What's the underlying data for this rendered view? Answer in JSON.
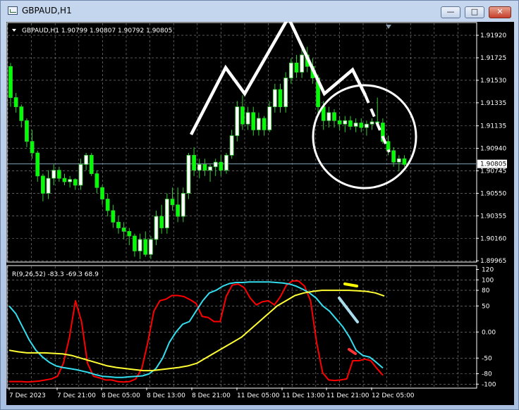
{
  "window": {
    "title": "GBPAUD,H1",
    "minimize_icon": "minimize-icon",
    "maximize_icon": "maximize-icon",
    "close_icon": "close-icon"
  },
  "chart_header": {
    "symbol_info": "GBPAUD,H1  1.90799 1.90807 1.90792 1.90805"
  },
  "indicator_header": {
    "info": "R(9,26,52) -83.3 -69.3 68.9"
  },
  "colors": {
    "background": "#000000",
    "grid": "#c8c8c8",
    "candle_up": "#ffffff",
    "candle_down": "#00ff00",
    "wick": "#33cc33",
    "line_red": "#ff0000",
    "line_cyan": "#33ddee",
    "line_yellow": "#ffff33",
    "annotation_white": "#ffffff",
    "annotation_yellow": "#ffff00",
    "annotation_lightblue": "#aaddee",
    "annotation_red": "#ff3333"
  },
  "chart_data": [
    {
      "type": "candlestick",
      "symbol": "GBPAUD",
      "timeframe": "H1",
      "ylim": [
        1.8996,
        1.92
      ],
      "price_ticks": [
        "1.91920",
        "1.91725",
        "1.91530",
        "1.91335",
        "1.91135",
        "1.90940",
        "1.90805",
        "1.90745",
        "1.90550",
        "1.90355",
        "1.90160",
        "1.89965"
      ],
      "current_price": "1.90805",
      "x_ticks": [
        "7 Dec 2023",
        "7 Dec 21:00",
        "8 Dec 05:00",
        "8 Dec 13:00",
        "8 Dec 21:00",
        "11 Dec 05:00",
        "11 Dec 13:00",
        "11 Dec 21:00",
        "12 Dec 05:00"
      ],
      "candles": [
        [
          1.9165,
          1.9168,
          1.913,
          1.9138
        ],
        [
          1.9138,
          1.9142,
          1.9125,
          1.913
        ],
        [
          1.913,
          1.9132,
          1.9112,
          1.9118
        ],
        [
          1.9118,
          1.912,
          1.9095,
          1.91
        ],
        [
          1.91,
          1.911,
          1.9085,
          1.909
        ],
        [
          1.909,
          1.9092,
          1.9065,
          1.907
        ],
        [
          1.907,
          1.9072,
          1.9048,
          1.9055
        ],
        [
          1.9055,
          1.9075,
          1.905,
          1.9068
        ],
        [
          1.9068,
          1.908,
          1.9062,
          1.9075
        ],
        [
          1.9075,
          1.9078,
          1.9065,
          1.9068
        ],
        [
          1.9068,
          1.9072,
          1.9062,
          1.9065
        ],
        [
          1.9065,
          1.907,
          1.906,
          1.9067
        ],
        [
          1.9067,
          1.9068,
          1.9058,
          1.9062
        ],
        [
          1.9062,
          1.9085,
          1.9058,
          1.908
        ],
        [
          1.908,
          1.909,
          1.9075,
          1.9088
        ],
        [
          1.9088,
          1.909,
          1.907,
          1.9072
        ],
        [
          1.9072,
          1.9075,
          1.9055,
          1.906
        ],
        [
          1.906,
          1.9062,
          1.9045,
          1.905
        ],
        [
          1.905,
          1.9055,
          1.9035,
          1.904
        ],
        [
          1.904,
          1.9045,
          1.9025,
          1.903
        ],
        [
          1.903,
          1.9035,
          1.902,
          1.9025
        ],
        [
          1.9025,
          1.903,
          1.9015,
          1.9022
        ],
        [
          1.9022,
          1.9025,
          1.901,
          1.9018
        ],
        [
          1.9018,
          1.902,
          1.9,
          1.9005
        ],
        [
          1.9005,
          1.902,
          1.8998,
          1.9015
        ],
        [
          1.9015,
          1.9022,
          1.9,
          1.9002
        ],
        [
          1.9002,
          1.9018,
          1.8998,
          1.9015
        ],
        [
          1.9015,
          1.904,
          1.901,
          1.9035
        ],
        [
          1.9035,
          1.9045,
          1.902,
          1.9025
        ],
        [
          1.9025,
          1.9055,
          1.902,
          1.905
        ],
        [
          1.905,
          1.906,
          1.904,
          1.9045
        ],
        [
          1.9045,
          1.906,
          1.903,
          1.9035
        ],
        [
          1.9035,
          1.906,
          1.903,
          1.9055
        ],
        [
          1.9055,
          1.909,
          1.905,
          1.9088
        ],
        [
          1.9088,
          1.9095,
          1.907,
          1.9075
        ],
        [
          1.9075,
          1.9085,
          1.9068,
          1.908
        ],
        [
          1.908,
          1.9085,
          1.907,
          1.9075
        ],
        [
          1.9075,
          1.908,
          1.9065,
          1.9078
        ],
        [
          1.9078,
          1.9085,
          1.907,
          1.9082
        ],
        [
          1.9082,
          1.9088,
          1.907,
          1.9075
        ],
        [
          1.9075,
          1.909,
          1.9072,
          1.9088
        ],
        [
          1.9088,
          1.911,
          1.9085,
          1.9105
        ],
        [
          1.9105,
          1.9135,
          1.91,
          1.913
        ],
        [
          1.913,
          1.914,
          1.911,
          1.9115
        ],
        [
          1.9115,
          1.913,
          1.911,
          1.9125
        ],
        [
          1.9125,
          1.913,
          1.9105,
          1.911
        ],
        [
          1.911,
          1.9125,
          1.9105,
          1.912
        ],
        [
          1.912,
          1.9122,
          1.9105,
          1.911
        ],
        [
          1.911,
          1.9135,
          1.9108,
          1.913
        ],
        [
          1.913,
          1.915,
          1.9125,
          1.9145
        ],
        [
          1.9145,
          1.915,
          1.9125,
          1.913
        ],
        [
          1.913,
          1.916,
          1.9125,
          1.9155
        ],
        [
          1.9155,
          1.9172,
          1.915,
          1.9168
        ],
        [
          1.9168,
          1.9175,
          1.9155,
          1.916
        ],
        [
          1.916,
          1.918,
          1.9155,
          1.9175
        ],
        [
          1.9175,
          1.9182,
          1.916,
          1.9165
        ],
        [
          1.9165,
          1.9172,
          1.915,
          1.9155
        ],
        [
          1.9155,
          1.9158,
          1.9125,
          1.913
        ],
        [
          1.913,
          1.9135,
          1.911,
          1.9118
        ],
        [
          1.9118,
          1.913,
          1.9112,
          1.9125
        ],
        [
          1.9125,
          1.9128,
          1.9112,
          1.9118
        ],
        [
          1.9118,
          1.9122,
          1.911,
          1.9115
        ],
        [
          1.9115,
          1.9122,
          1.9108,
          1.9118
        ],
        [
          1.9118,
          1.9122,
          1.911,
          1.9113
        ],
        [
          1.9113,
          1.912,
          1.9108,
          1.9116
        ],
        [
          1.9116,
          1.912,
          1.9108,
          1.9112
        ],
        [
          1.9112,
          1.9118,
          1.9105,
          1.9115
        ],
        [
          1.9115,
          1.912,
          1.911,
          1.9117
        ],
        [
          1.9117,
          1.9138,
          1.9112,
          1.9116
        ],
        [
          1.9116,
          1.912,
          1.9098,
          1.91
        ],
        [
          1.91,
          1.9105,
          1.9088,
          1.9092
        ],
        [
          1.9092,
          1.9095,
          1.9078,
          1.9082
        ],
        [
          1.9082,
          1.9088,
          1.9074,
          1.9085
        ],
        [
          1.9085,
          1.9088,
          1.9078,
          1.908
        ]
      ]
    },
    {
      "type": "line",
      "indicator": "R(9,26,52)",
      "values_shown": [
        "-83.3",
        "-69.3",
        "68.9"
      ],
      "ylim": [
        -105,
        122
      ],
      "y_ticks": [
        "120",
        "100",
        "80",
        "50",
        "0.00",
        "-50",
        "-80",
        "-100"
      ],
      "series": [
        {
          "color": "#ff0000",
          "values": [
            -95,
            -95,
            -95,
            -96,
            -95,
            -94,
            -92,
            -90,
            -85,
            -60,
            -10,
            60,
            20,
            -60,
            -85,
            -88,
            -92,
            -92,
            -95,
            -96,
            -95,
            -90,
            -70,
            -20,
            40,
            60,
            63,
            70,
            70,
            68,
            62,
            55,
            30,
            28,
            20,
            20,
            68,
            90,
            92,
            85,
            65,
            52,
            58,
            60,
            52,
            68,
            90,
            98,
            98,
            88,
            60,
            -20,
            -78,
            -92,
            -93,
            -92,
            -90,
            -55,
            -55,
            -52,
            -55,
            -70,
            -83
          ]
        },
        {
          "color": "#33ddee",
          "values": [
            50,
            35,
            10,
            -15,
            -35,
            -48,
            -58,
            -65,
            -68,
            -70,
            -72,
            -75,
            -78,
            -82,
            -85,
            -86,
            -87,
            -87,
            -86,
            -85,
            -84,
            -80,
            -70,
            -50,
            -20,
            0,
            15,
            20,
            40,
            60,
            75,
            80,
            88,
            93,
            95,
            95,
            96,
            96,
            96,
            96,
            95,
            94,
            92,
            88,
            82,
            75,
            65,
            50,
            40,
            25,
            10,
            -10,
            -35,
            -45,
            -48,
            -58,
            -69
          ]
        },
        {
          "color": "#ffff33",
          "values": [
            -35,
            -38,
            -40,
            -40,
            -40,
            -41,
            -42,
            -45,
            -50,
            -55,
            -60,
            -65,
            -68,
            -70,
            -72,
            -74,
            -74,
            -72,
            -70,
            -68,
            -65,
            -60,
            -50,
            -40,
            -30,
            -20,
            -10,
            5,
            20,
            35,
            50,
            60,
            70,
            75,
            78,
            80,
            80,
            80,
            80,
            79,
            78,
            75,
            69
          ]
        }
      ]
    }
  ],
  "annotations": {
    "pattern_line_label": "head-and-shoulders-outline",
    "circle_label": "highlight-circle"
  }
}
